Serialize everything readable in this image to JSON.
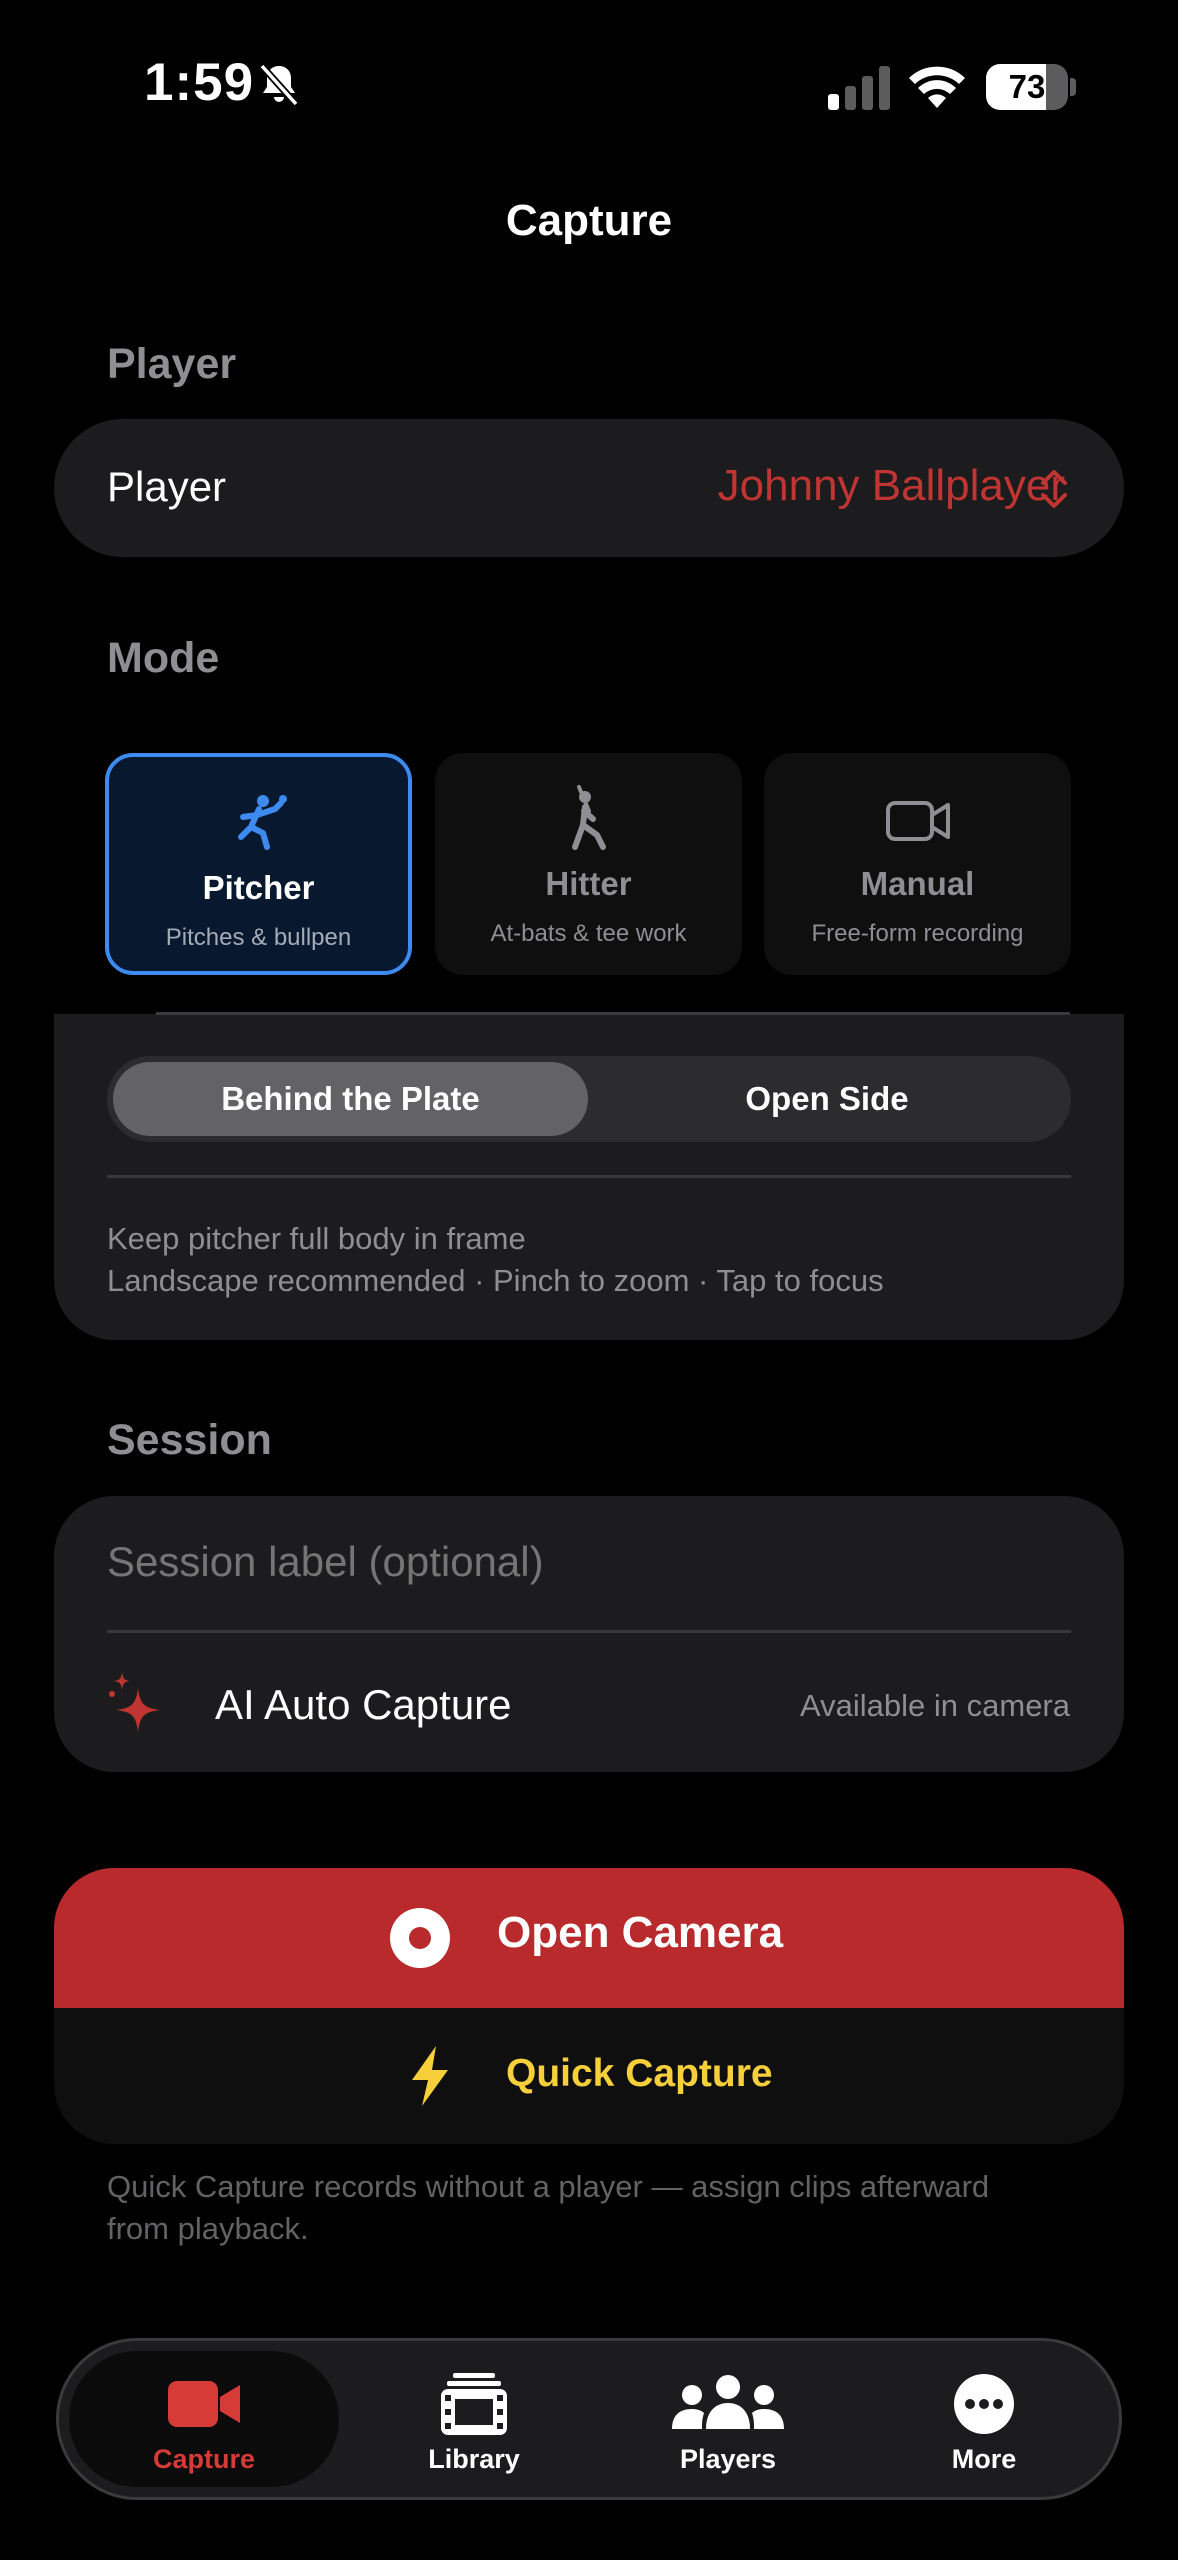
{
  "status_bar": {
    "time": "1:59",
    "battery": "73"
  },
  "header": {
    "title": "Capture"
  },
  "player_section": {
    "heading": "Player",
    "row_label": "Player",
    "selected_player": "Johnny Ballplayer"
  },
  "mode_section": {
    "heading": "Mode",
    "modes": [
      {
        "name": "Pitcher",
        "subtitle": "Pitches & bullpen",
        "icon": "pitcher-icon",
        "selected": true
      },
      {
        "name": "Hitter",
        "subtitle": "At-bats & tee work",
        "icon": "hitter-icon",
        "selected": false
      },
      {
        "name": "Manual",
        "subtitle": "Free-form recording",
        "icon": "video-camera-icon",
        "selected": false
      }
    ]
  },
  "camera_position": {
    "options": [
      "Behind the Plate",
      "Open Side"
    ],
    "selected": "Behind the Plate",
    "hint_line1": "Keep pitcher full body in frame",
    "hint_line2": "Landscape recommended · Pinch to zoom · Tap to focus"
  },
  "session_section": {
    "heading": "Session",
    "label_placeholder": "Session label (optional)",
    "label_value": "",
    "ai_label": "AI Auto Capture",
    "ai_status": "Available in camera"
  },
  "actions": {
    "open_camera": "Open Camera",
    "quick_capture": "Quick Capture",
    "quick_capture_note": "Quick Capture records without a player — assign clips afterward from playback."
  },
  "tabbar": {
    "tabs": [
      {
        "label": "Capture",
        "icon": "video-camera-icon",
        "active": true
      },
      {
        "label": "Library",
        "icon": "film-stack-icon",
        "active": false
      },
      {
        "label": "Players",
        "icon": "people-icon",
        "active": false
      },
      {
        "label": "More",
        "icon": "more-icon",
        "active": false
      }
    ]
  },
  "colors": {
    "accent_red": "#b82a2b",
    "player_red": "#c03531",
    "selected_blue": "#3d8bf0",
    "quick_yellow": "#f6cf3b"
  }
}
